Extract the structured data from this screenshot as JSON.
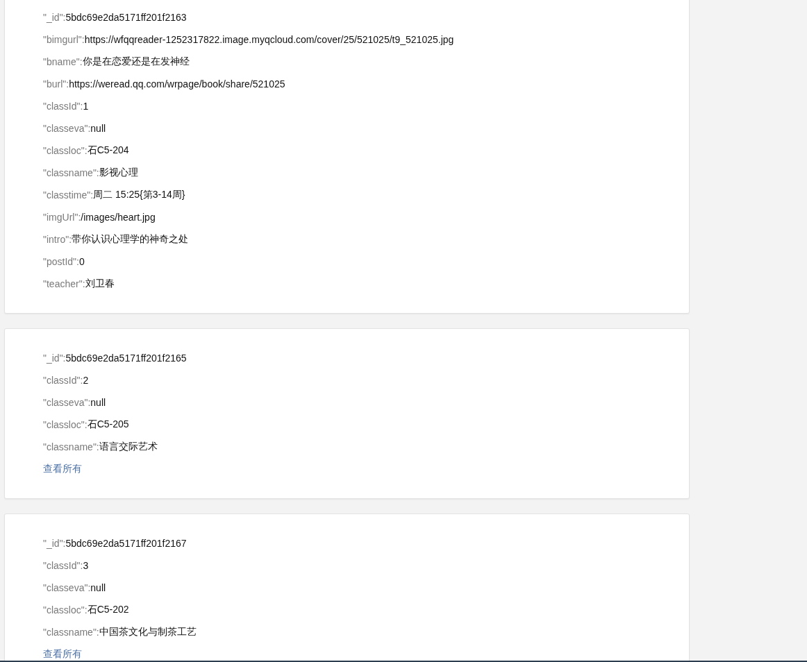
{
  "cards": [
    {
      "fields": [
        {
          "key": "\"_id\":",
          "value": "5bdc69e2da5171ff201f2163"
        },
        {
          "key": "\"bimgurl\":",
          "value": "https://wfqqreader-1252317822.image.myqcloud.com/cover/25/521025/t9_521025.jpg"
        },
        {
          "key": "\"bname\":",
          "value": "你是在恋爱还是在发神经"
        },
        {
          "key": "\"burl\":",
          "value": "https://weread.qq.com/wrpage/book/share/521025"
        },
        {
          "key": "\"classId\":",
          "value": "1"
        },
        {
          "key": "\"classeva\":",
          "value": "null"
        },
        {
          "key": "\"classloc\":",
          "value": "石C5-204"
        },
        {
          "key": "\"classname\":",
          "value": "影视心理"
        },
        {
          "key": "\"classtime\":",
          "value": "周二 15:25{第3-14周}"
        },
        {
          "key": "\"imgUrl\":",
          "value": "/images/heart.jpg"
        },
        {
          "key": "\"intro\":",
          "value": "带你认识心理学的神奇之处"
        },
        {
          "key": "\"postId\":",
          "value": "0"
        },
        {
          "key": "\"teacher\":",
          "value": "刘卫春"
        }
      ]
    },
    {
      "fields": [
        {
          "key": "\"_id\":",
          "value": "5bdc69e2da5171ff201f2165"
        },
        {
          "key": "\"classId\":",
          "value": "2"
        },
        {
          "key": "\"classeva\":",
          "value": "null"
        },
        {
          "key": "\"classloc\":",
          "value": "石C5-205"
        },
        {
          "key": "\"classname\":",
          "value": "语言交际艺术"
        }
      ],
      "link": "查看所有"
    },
    {
      "fields": [
        {
          "key": "\"_id\":",
          "value": "5bdc69e2da5171ff201f2167"
        },
        {
          "key": "\"classId\":",
          "value": "3"
        },
        {
          "key": "\"classeva\":",
          "value": "null"
        },
        {
          "key": "\"classloc\":",
          "value": "石C5-202"
        },
        {
          "key": "\"classname\":",
          "value": "中国茶文化与制茶工艺"
        }
      ],
      "link": "查看所有"
    }
  ]
}
